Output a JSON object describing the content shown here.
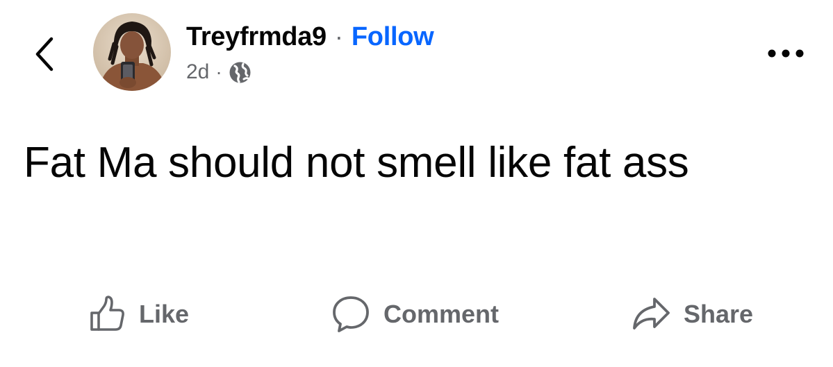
{
  "post": {
    "author": "Treyfrmda9",
    "separator": "·",
    "follow_label": "Follow",
    "timestamp": "2d",
    "meta_separator": "·",
    "visibility_icon": "globe-icon",
    "text": "Fat Ma should not smell like fat ass"
  },
  "navigation": {
    "back_icon": "chevron-left-icon",
    "more_icon": "more-horizontal-icon"
  },
  "actions": {
    "like_label": "Like",
    "comment_label": "Comment",
    "share_label": "Share"
  },
  "colors": {
    "link_blue": "#0866ff",
    "secondary_text": "#65676b",
    "primary_text": "#050505"
  }
}
